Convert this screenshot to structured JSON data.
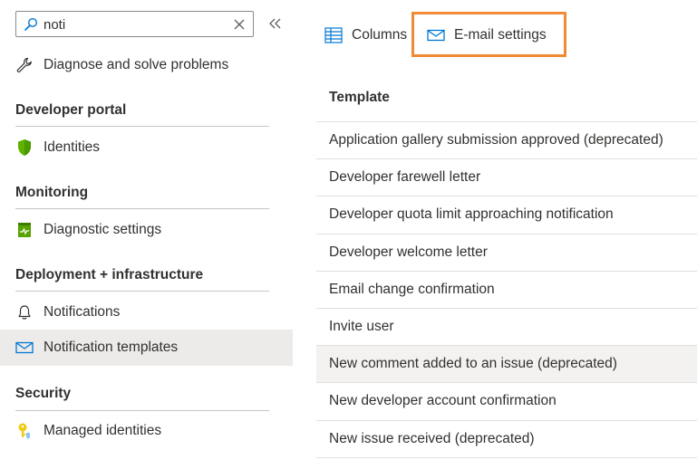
{
  "search": {
    "value": "noti",
    "placeholder": ""
  },
  "sidebar": {
    "top_items": [
      {
        "label": "Diagnose and solve problems",
        "icon": "wrench-icon"
      }
    ],
    "sections": [
      {
        "title": "Developer portal",
        "items": [
          {
            "label": "Identities",
            "icon": "shield-icon"
          }
        ]
      },
      {
        "title": "Monitoring",
        "items": [
          {
            "label": "Diagnostic settings",
            "icon": "diagnostic-icon"
          }
        ]
      },
      {
        "title": "Deployment + infrastructure",
        "items": [
          {
            "label": "Notifications",
            "icon": "bell-icon"
          },
          {
            "label": "Notification templates",
            "icon": "mail-icon",
            "selected": true
          }
        ]
      },
      {
        "title": "Security",
        "items": [
          {
            "label": "Managed identities",
            "icon": "key-icon"
          }
        ]
      }
    ]
  },
  "toolbar": {
    "columns_label": "Columns",
    "email_settings_label": "E-mail settings"
  },
  "table": {
    "header": "Template",
    "rows": [
      "Application gallery submission approved (deprecated)",
      "Developer farewell letter",
      "Developer quota limit approaching notification",
      "Developer welcome letter",
      "Email change confirmation",
      "Invite user",
      "New comment added to an issue (deprecated)",
      "New developer account confirmation",
      "New issue received (deprecated)"
    ],
    "hovered_row_index": 6
  },
  "colors": {
    "accent": "#0078d4",
    "highlight": "#f08a33",
    "selected_bg": "#edebe9",
    "shield_green": "#5db300"
  }
}
